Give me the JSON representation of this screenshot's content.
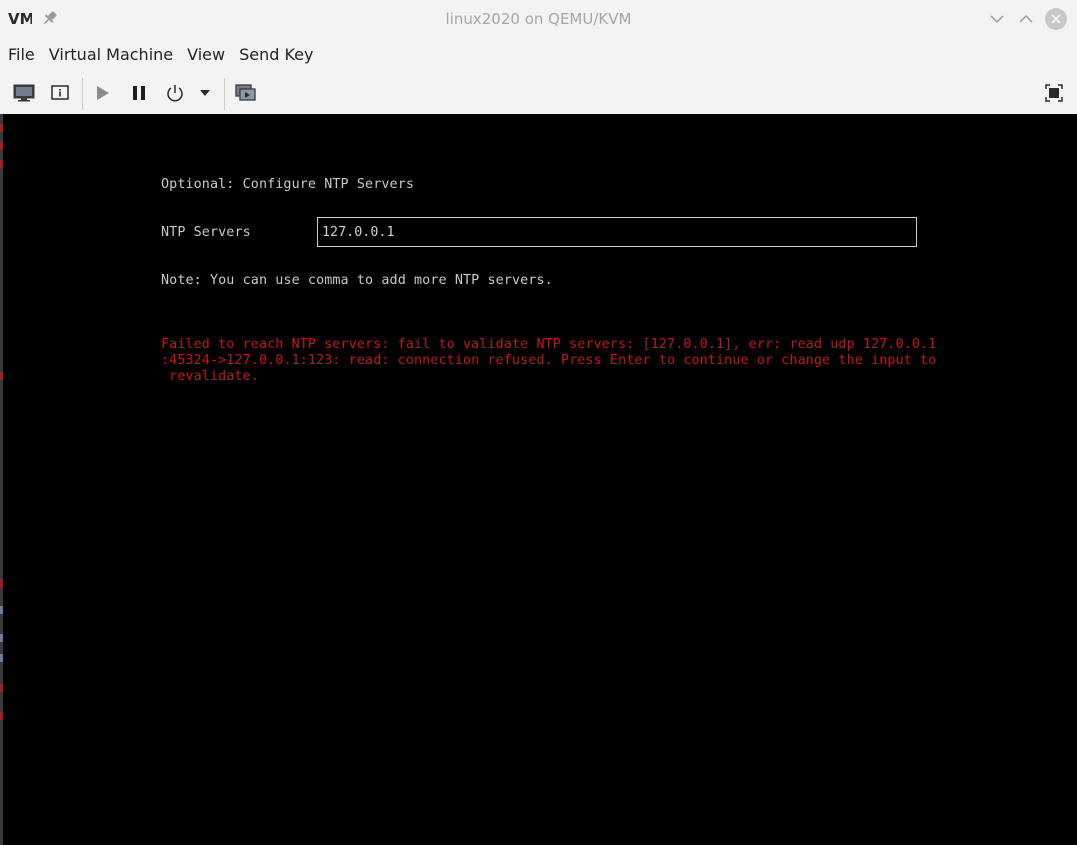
{
  "window": {
    "title": "linux2020 on QEMU/KVM",
    "app_logo": "VM"
  },
  "menu": {
    "items": [
      "File",
      "Virtual Machine",
      "View",
      "Send Key"
    ]
  },
  "toolbar": {
    "icons": [
      "monitor-icon",
      "info-icon",
      "play-icon",
      "pause-icon",
      "power-icon",
      "dropdown-arrow-icon",
      "snapshot-icon",
      "fullscreen-icon"
    ]
  },
  "console": {
    "heading": "Optional: Configure NTP Servers",
    "field_label": "NTP Servers",
    "field_value": "127.0.0.1",
    "note": "Note: You can use comma to add more NTP servers.",
    "error_line1": "Failed to reach NTP servers: fail to validate NTP servers: [127.0.0.1], err: read udp 127.0.0.1",
    "error_line2": ":45324->127.0.0.1:123: read: connection refused. Press Enter to continue or change the input to",
    "error_line3": " revalidate."
  },
  "colors": {
    "error": "#c5161d",
    "console_text": "#c9c9c9",
    "background": "#000000",
    "chrome": "#f3f3f3"
  }
}
